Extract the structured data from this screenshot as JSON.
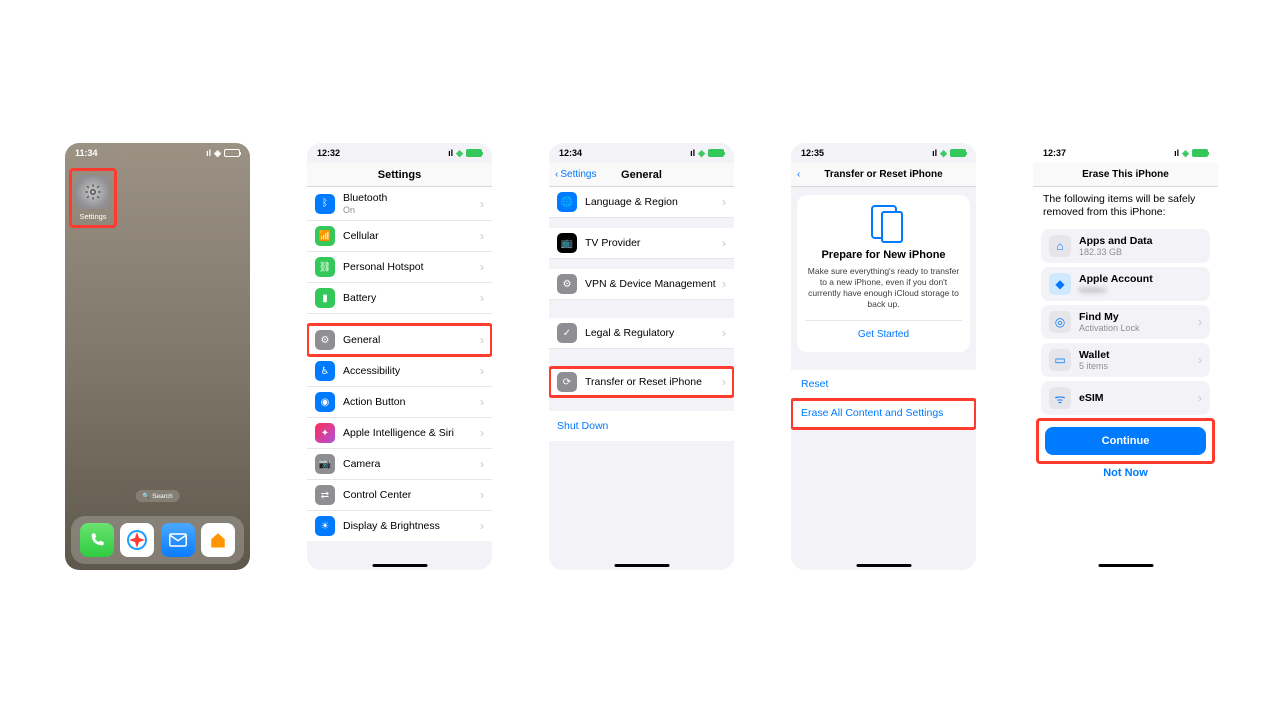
{
  "screen1": {
    "time": "11:34",
    "app_label": "Settings",
    "search": "Search"
  },
  "screen2": {
    "time": "12:32",
    "title": "Settings",
    "bluetooth": "Bluetooth",
    "bluetooth_status": "On",
    "cellular": "Cellular",
    "hotspot": "Personal Hotspot",
    "battery": "Battery",
    "general": "General",
    "accessibility": "Accessibility",
    "action_button": "Action Button",
    "ai_siri": "Apple Intelligence & Siri",
    "camera": "Camera",
    "control_center": "Control Center",
    "display": "Display & Brightness"
  },
  "screen3": {
    "time": "12:34",
    "back": "Settings",
    "title": "General",
    "lang": "Language & Region",
    "tv": "TV Provider",
    "vpn": "VPN & Device Management",
    "legal": "Legal & Regulatory",
    "transfer": "Transfer or Reset iPhone",
    "shutdown": "Shut Down"
  },
  "screen4": {
    "time": "12:35",
    "title": "Transfer or Reset iPhone",
    "prepare_title": "Prepare for New iPhone",
    "prepare_body": "Make sure everything's ready to transfer to a new iPhone, even if you don't currently have enough iCloud storage to back up.",
    "get_started": "Get Started",
    "reset": "Reset",
    "erase": "Erase All Content and Settings"
  },
  "screen5": {
    "time": "12:37",
    "title": "Erase This iPhone",
    "intro": "The following items will be safely removed from this iPhone:",
    "apps": "Apps and Data",
    "apps_sub": "182.33 GB",
    "account": "Apple Account",
    "findmy": "Find My",
    "findmy_sub": "Activation Lock",
    "wallet": "Wallet",
    "wallet_sub": "5 items",
    "esim": "eSIM",
    "continue": "Continue",
    "notnow": "Not Now"
  }
}
